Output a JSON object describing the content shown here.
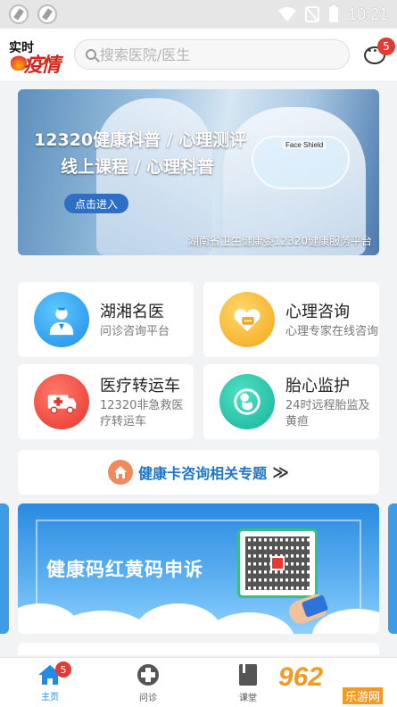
{
  "status_bar": {
    "time": "10:21"
  },
  "header": {
    "logo_line1": "实时",
    "logo_line2": "疫情",
    "search_placeholder": "搜索医院/医生",
    "message_badge": "5"
  },
  "banner": {
    "title_line1": "12320健康科普 / 心理测评",
    "title_line2": "线上课程 / 心理科普",
    "enter_button": "点击进入",
    "footer": "湖南省卫生健康委12320健康服务平台",
    "shield_label": "Face Shield"
  },
  "services": [
    {
      "title": "湖湘名医",
      "subtitle": "问诊咨询平台",
      "icon": "doctor-icon",
      "color": "#1f8de8"
    },
    {
      "title": "心理咨询",
      "subtitle": "心理专家在线咨询",
      "icon": "heart-chat-icon",
      "color": "#f2a61a"
    },
    {
      "title": "医疗转运车",
      "subtitle": "12320非急救医疗转运车",
      "icon": "ambulance-icon",
      "color": "#e8352c"
    },
    {
      "title": "胎心监护",
      "subtitle": "24时远程胎监及黄疸",
      "icon": "fetus-icon",
      "color": "#16b39a"
    }
  ],
  "topic": {
    "label": "健康卡咨询相关专题",
    "chevron": "≫"
  },
  "appeal": {
    "title": "健康码红黄码申诉"
  },
  "tabs": [
    {
      "label": "主页",
      "badge": "5",
      "active": true
    },
    {
      "label": "问诊",
      "active": false
    },
    {
      "label": "课堂",
      "active": false
    }
  ],
  "watermark": {
    "big": "962",
    "small": "乐游网"
  }
}
